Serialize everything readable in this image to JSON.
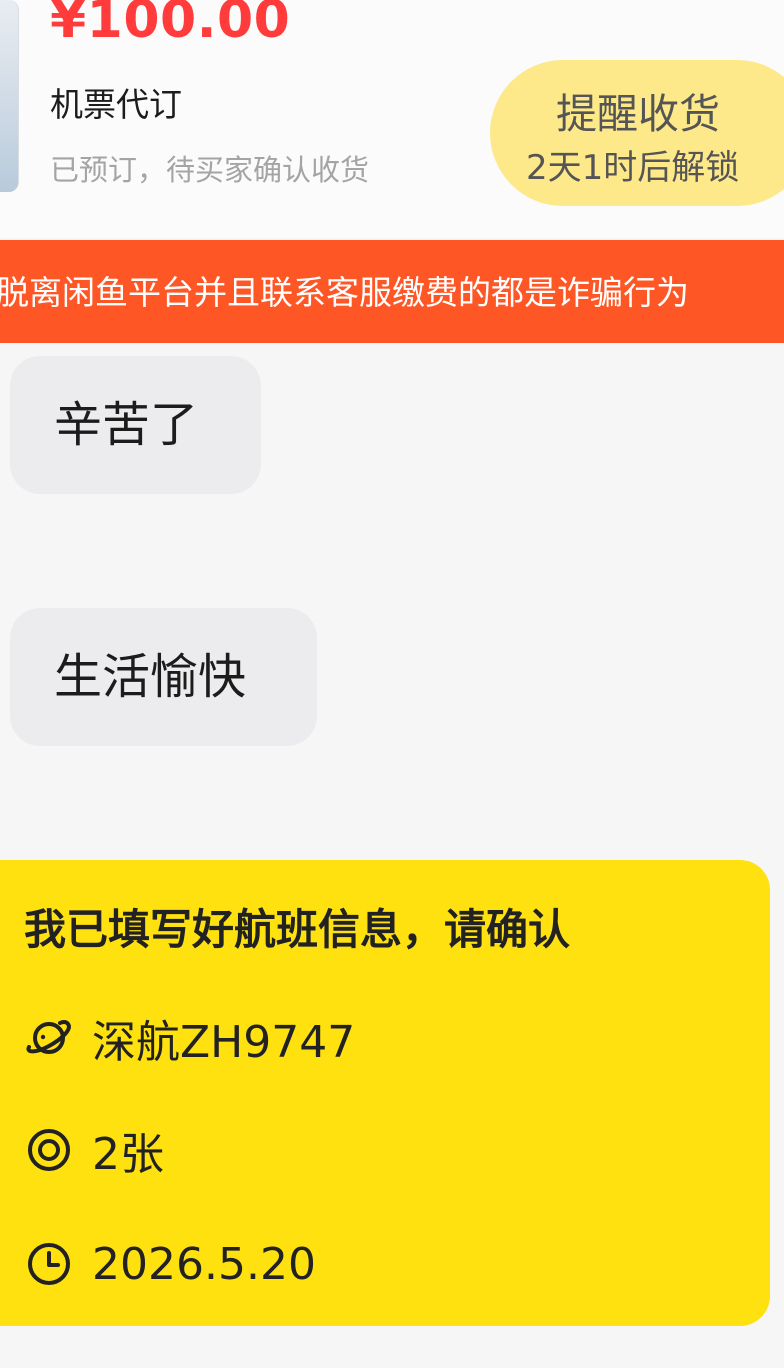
{
  "order": {
    "price": "¥100.00",
    "title": "机票代订",
    "status": "已预订，待买家确认收货",
    "remind_button": {
      "label": "提醒收货",
      "sublabel": "2天1时后解锁"
    }
  },
  "warning_banner": {
    "text": "脱离闲鱼平台并且联系客服缴费的都是诈骗行为"
  },
  "messages": [
    {
      "text": "辛苦了"
    },
    {
      "text": "生活愉快"
    }
  ],
  "flight_card": {
    "title": "我已填写好航班信息，请确认",
    "flight": {
      "icon": "planet-icon",
      "value": "深航ZH9747"
    },
    "count": {
      "icon": "target-icon",
      "value": "2张"
    },
    "date": {
      "icon": "clock-icon",
      "value": "2026.5.20"
    }
  },
  "colors": {
    "price": "#ff3b3b",
    "remind_button_bg": "#fde98a",
    "warning_bg": "#ff5625",
    "flight_card_bg": "#ffe10f",
    "bubble_bg": "#ececee"
  }
}
